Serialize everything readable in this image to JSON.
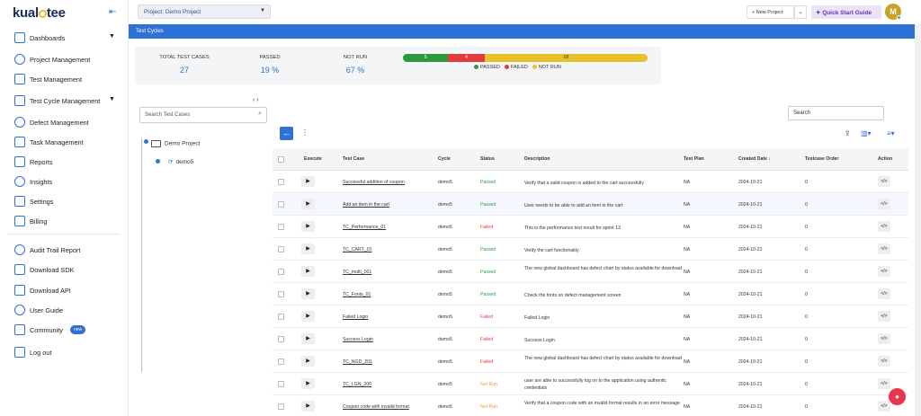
{
  "brand": {
    "logo": "kualitee"
  },
  "sidebar": {
    "items": [
      {
        "label": "Dashboards",
        "icon": "dashboard-icon",
        "has_caret": true
      },
      {
        "label": "Project Management",
        "icon": "project-management-icon"
      },
      {
        "label": "Test Management",
        "icon": "test-management-icon"
      },
      {
        "label": "Test Cycle Management",
        "icon": "test-cycle-icon",
        "has_caret": true
      },
      {
        "label": "Defect Management",
        "icon": "defect-icon"
      },
      {
        "label": "Task Management",
        "icon": "task-icon"
      },
      {
        "label": "Reports",
        "icon": "reports-icon"
      },
      {
        "label": "Insights",
        "icon": "insights-icon"
      },
      {
        "label": "Settings",
        "icon": "settings-icon"
      },
      {
        "label": "Billing",
        "icon": "billing-icon"
      },
      {
        "label": "Audit Trail Report",
        "icon": "audit-icon"
      },
      {
        "label": "Download SDK",
        "icon": "sdk-icon"
      },
      {
        "label": "Download API",
        "icon": "api-icon"
      },
      {
        "label": "User Guide",
        "icon": "user-guide-icon"
      },
      {
        "label": "Community",
        "icon": "community-icon",
        "badge": "new"
      },
      {
        "label": "Log out",
        "icon": "logout-icon"
      }
    ]
  },
  "topbar": {
    "project_label": "Project:",
    "project_value": "Demo Project",
    "new_project": "+ New Project",
    "quick_start": "Quick Start Guide",
    "avatar_initial": "M"
  },
  "page": {
    "title": "Test Cycles"
  },
  "stats": {
    "total_label": "TOTAL TEST CASES",
    "total_value": "27",
    "passed_label": "PASSED",
    "passed_value": "19 %",
    "notrun_label": "NOT RUN",
    "notrun_value": "67 %",
    "bar": [
      {
        "label": "5",
        "value": 5,
        "color": "#2e9a3e"
      },
      {
        "label": "4",
        "value": 4,
        "color": "#e23b3b"
      },
      {
        "label": "18",
        "value": 18,
        "color": "#e8c22a"
      }
    ],
    "legend": [
      "PASSED",
      "FAILED",
      "NOT RUN"
    ]
  },
  "tree": {
    "search_placeholder": "Search Test Cases",
    "root": "Demo Project",
    "child": "demo5"
  },
  "table": {
    "search_placeholder": "Search",
    "columns": [
      "Execute",
      "Test Case",
      "Cycle",
      "Status",
      "Description",
      "Test Plan",
      "Created Date",
      "Testcase Order",
      "Action"
    ],
    "rows": [
      {
        "name": "Successful addition of coupon",
        "cycle": "demo5",
        "status": "Passed",
        "desc": "Verify that a valid coupon is added to the cart successfully",
        "plan": "NA",
        "date": "2024-10-21",
        "order": "0"
      },
      {
        "name": "Add an item in the cart",
        "cycle": "demo5",
        "status": "Passed",
        "desc": "User needs to be able to add an item in the cart",
        "plan": "NA",
        "date": "2024-10-21",
        "order": "0"
      },
      {
        "name": "TC_Performance_01",
        "cycle": "demo5",
        "status": "Failed",
        "desc": "This is the performance test result for sprint 13",
        "plan": "NA",
        "date": "2024-10-21",
        "order": "0"
      },
      {
        "name": "TC_CART_01",
        "cycle": "demo5",
        "status": "Passed",
        "desc": "Verify the cart functionality",
        "plan": "NA",
        "date": "2024-10-21",
        "order": "0"
      },
      {
        "name": "TC_multi_001",
        "cycle": "demo5",
        "status": "Passed",
        "desc": "The new global dashboard has defect chart by status available for download",
        "plan": "NA",
        "date": "2024-10-21",
        "order": "0"
      },
      {
        "name": "TC_Fonts_01",
        "cycle": "demo5",
        "status": "Passed",
        "desc": "Check the fonts on defect management screen",
        "plan": "NA",
        "date": "2024-10-21",
        "order": "0"
      },
      {
        "name": "Failed Login",
        "cycle": "demo5",
        "status": "Failed",
        "desc": "Failed Login",
        "plan": "NA",
        "date": "2024-10-21",
        "order": "0"
      },
      {
        "name": "Success Login",
        "cycle": "demo5",
        "status": "Failed",
        "desc": "Success Login",
        "plan": "NA",
        "date": "2024-10-21",
        "order": "0"
      },
      {
        "name": "TC_NGD_201",
        "cycle": "demo5",
        "status": "Failed",
        "desc": "The new global dashboard has defect chart by status available for download",
        "plan": "NA",
        "date": "2024-10-21",
        "order": "0"
      },
      {
        "name": "TC_LGN_200",
        "cycle": "demo5",
        "status": "Not Run",
        "desc": "user are able to successfully log on to the application using authentic credentials",
        "plan": "NA",
        "date": "2024-10-21",
        "order": "0"
      },
      {
        "name": "Coupon code with invalid format",
        "cycle": "demo5",
        "status": "Not Run",
        "desc": "Verify that a coupon code with an invalid format results in an error message",
        "plan": "NA",
        "date": "2024-10-21",
        "order": "0"
      }
    ]
  }
}
